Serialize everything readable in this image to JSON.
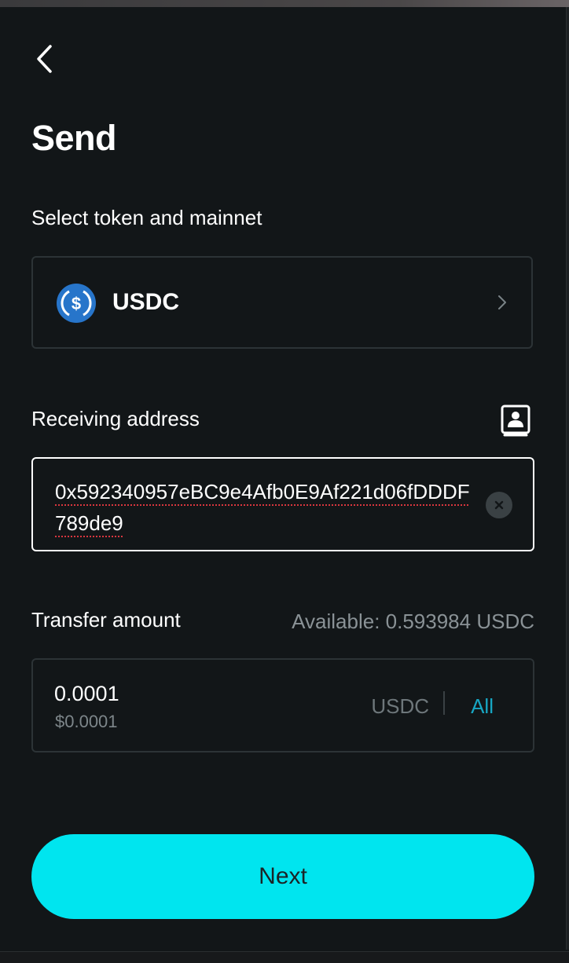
{
  "header": {
    "back_icon": "chevron-left-icon",
    "title": "Send"
  },
  "token_section": {
    "label": "Select token and mainnet",
    "token_name": "USDC",
    "token_icon": "usdc-icon",
    "chevron_icon": "chevron-right-icon"
  },
  "address_section": {
    "label": "Receiving address",
    "address_book_icon": "address-book-icon",
    "value": "0x592340957eBC9e4Afb0E9Af221d06fDDDF789de9",
    "clear_icon": "clear-icon"
  },
  "amount_section": {
    "label": "Transfer amount",
    "available": "Available: 0.593984 USDC",
    "value": "0.0001",
    "usd_value": "$0.0001",
    "unit": "USDC",
    "all_label": "All"
  },
  "next_label": "Next",
  "colors": {
    "background": "#121618",
    "accent": "#00e5ef",
    "link": "#17a7c4",
    "token_blue": "#2775ca"
  }
}
